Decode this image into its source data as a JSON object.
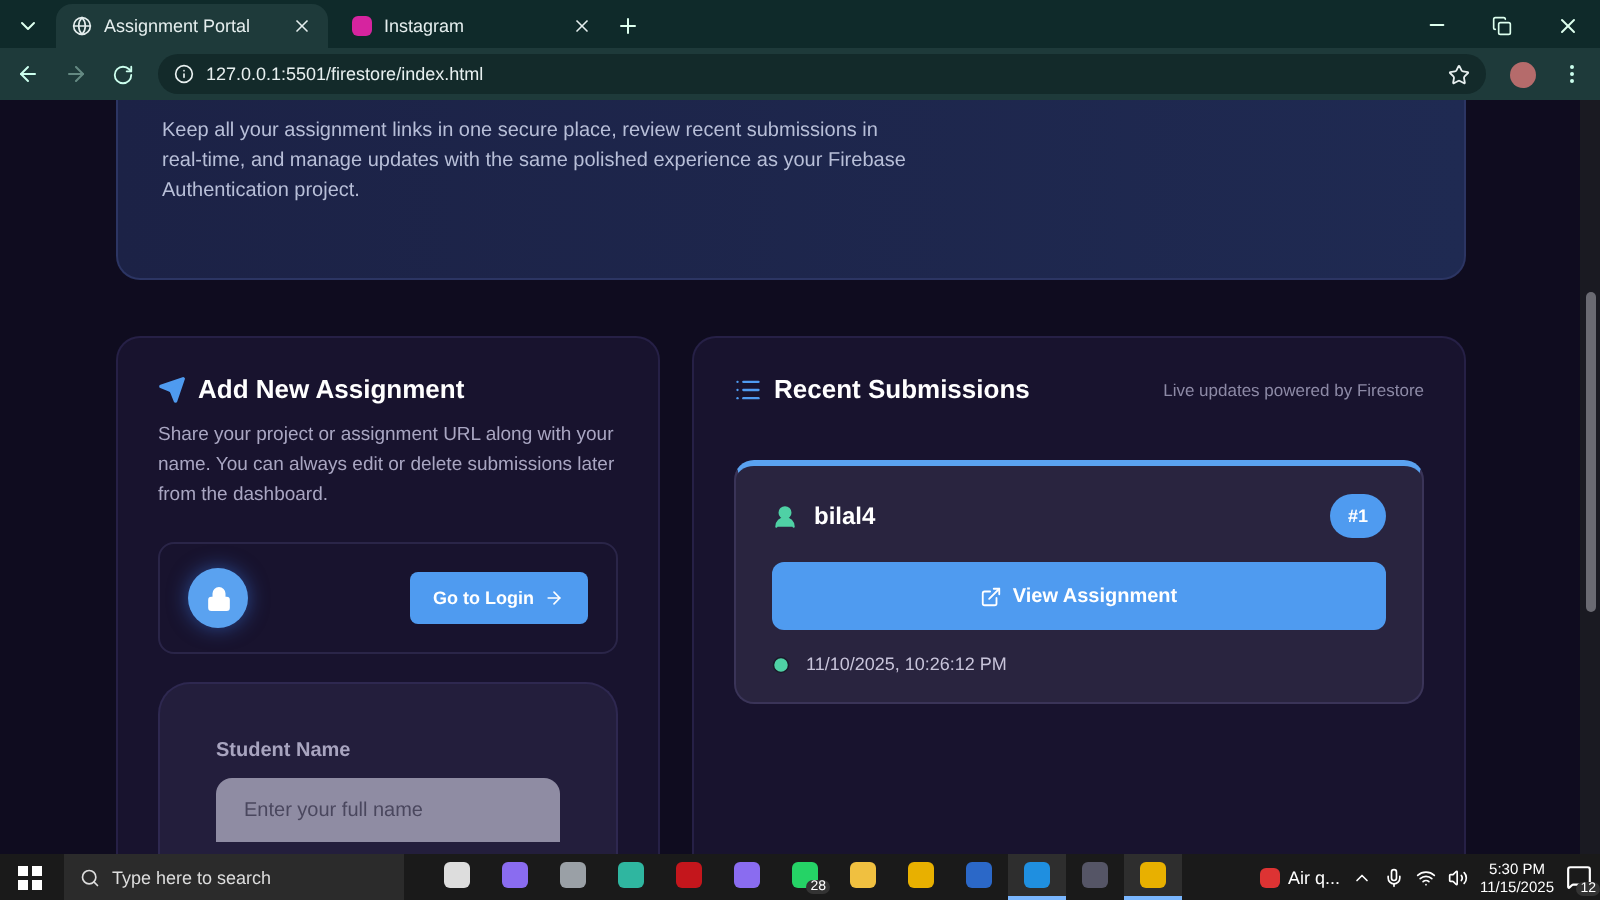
{
  "browser": {
    "tabs": [
      {
        "title": "Assignment Portal",
        "kind": "globe",
        "selected": true
      },
      {
        "title": "Instagram",
        "kind": "insta",
        "selected": false
      }
    ],
    "url": "127.0.0.1:5501/firestore/index.html"
  },
  "hero": {
    "text": "Keep all your assignment links in one secure place, review recent submissions in real-time, and manage updates with the same polished experience as your Firebase Authentication project."
  },
  "add_panel": {
    "title": "Add New Assignment",
    "description": "Share your project or assignment URL along with your name. You can always edit or delete submissions later from the dashboard.",
    "login_button": "Go to Login",
    "field_label": "Student Name",
    "field_placeholder": "Enter your full name"
  },
  "recent_panel": {
    "title": "Recent Submissions",
    "note": "Live updates powered by Firestore",
    "submissions": [
      {
        "name": "bilal4",
        "number": "#1",
        "button": "View Assignment",
        "time": "11/10/2025, 10:26:12 PM"
      }
    ]
  },
  "taskbar": {
    "search_placeholder": "Type here to search",
    "apps": [
      {
        "kind": "taskview",
        "active": false
      },
      {
        "kind": "copilot",
        "active": false
      },
      {
        "kind": "files",
        "active": false
      },
      {
        "kind": "edge",
        "active": false
      },
      {
        "kind": "pdf",
        "active": false
      },
      {
        "kind": "copilot",
        "active": false
      },
      {
        "kind": "chat",
        "active": false,
        "badge": "28"
      },
      {
        "kind": "folder",
        "active": false
      },
      {
        "kind": "chrome",
        "active": false
      },
      {
        "kind": "word",
        "active": false
      },
      {
        "kind": "code",
        "active": true
      },
      {
        "kind": "obs",
        "active": false
      },
      {
        "kind": "chrome",
        "active": true
      }
    ],
    "weather": "Air q...",
    "time": "5:30 PM",
    "date": "11/15/2025",
    "notifications": "12"
  }
}
